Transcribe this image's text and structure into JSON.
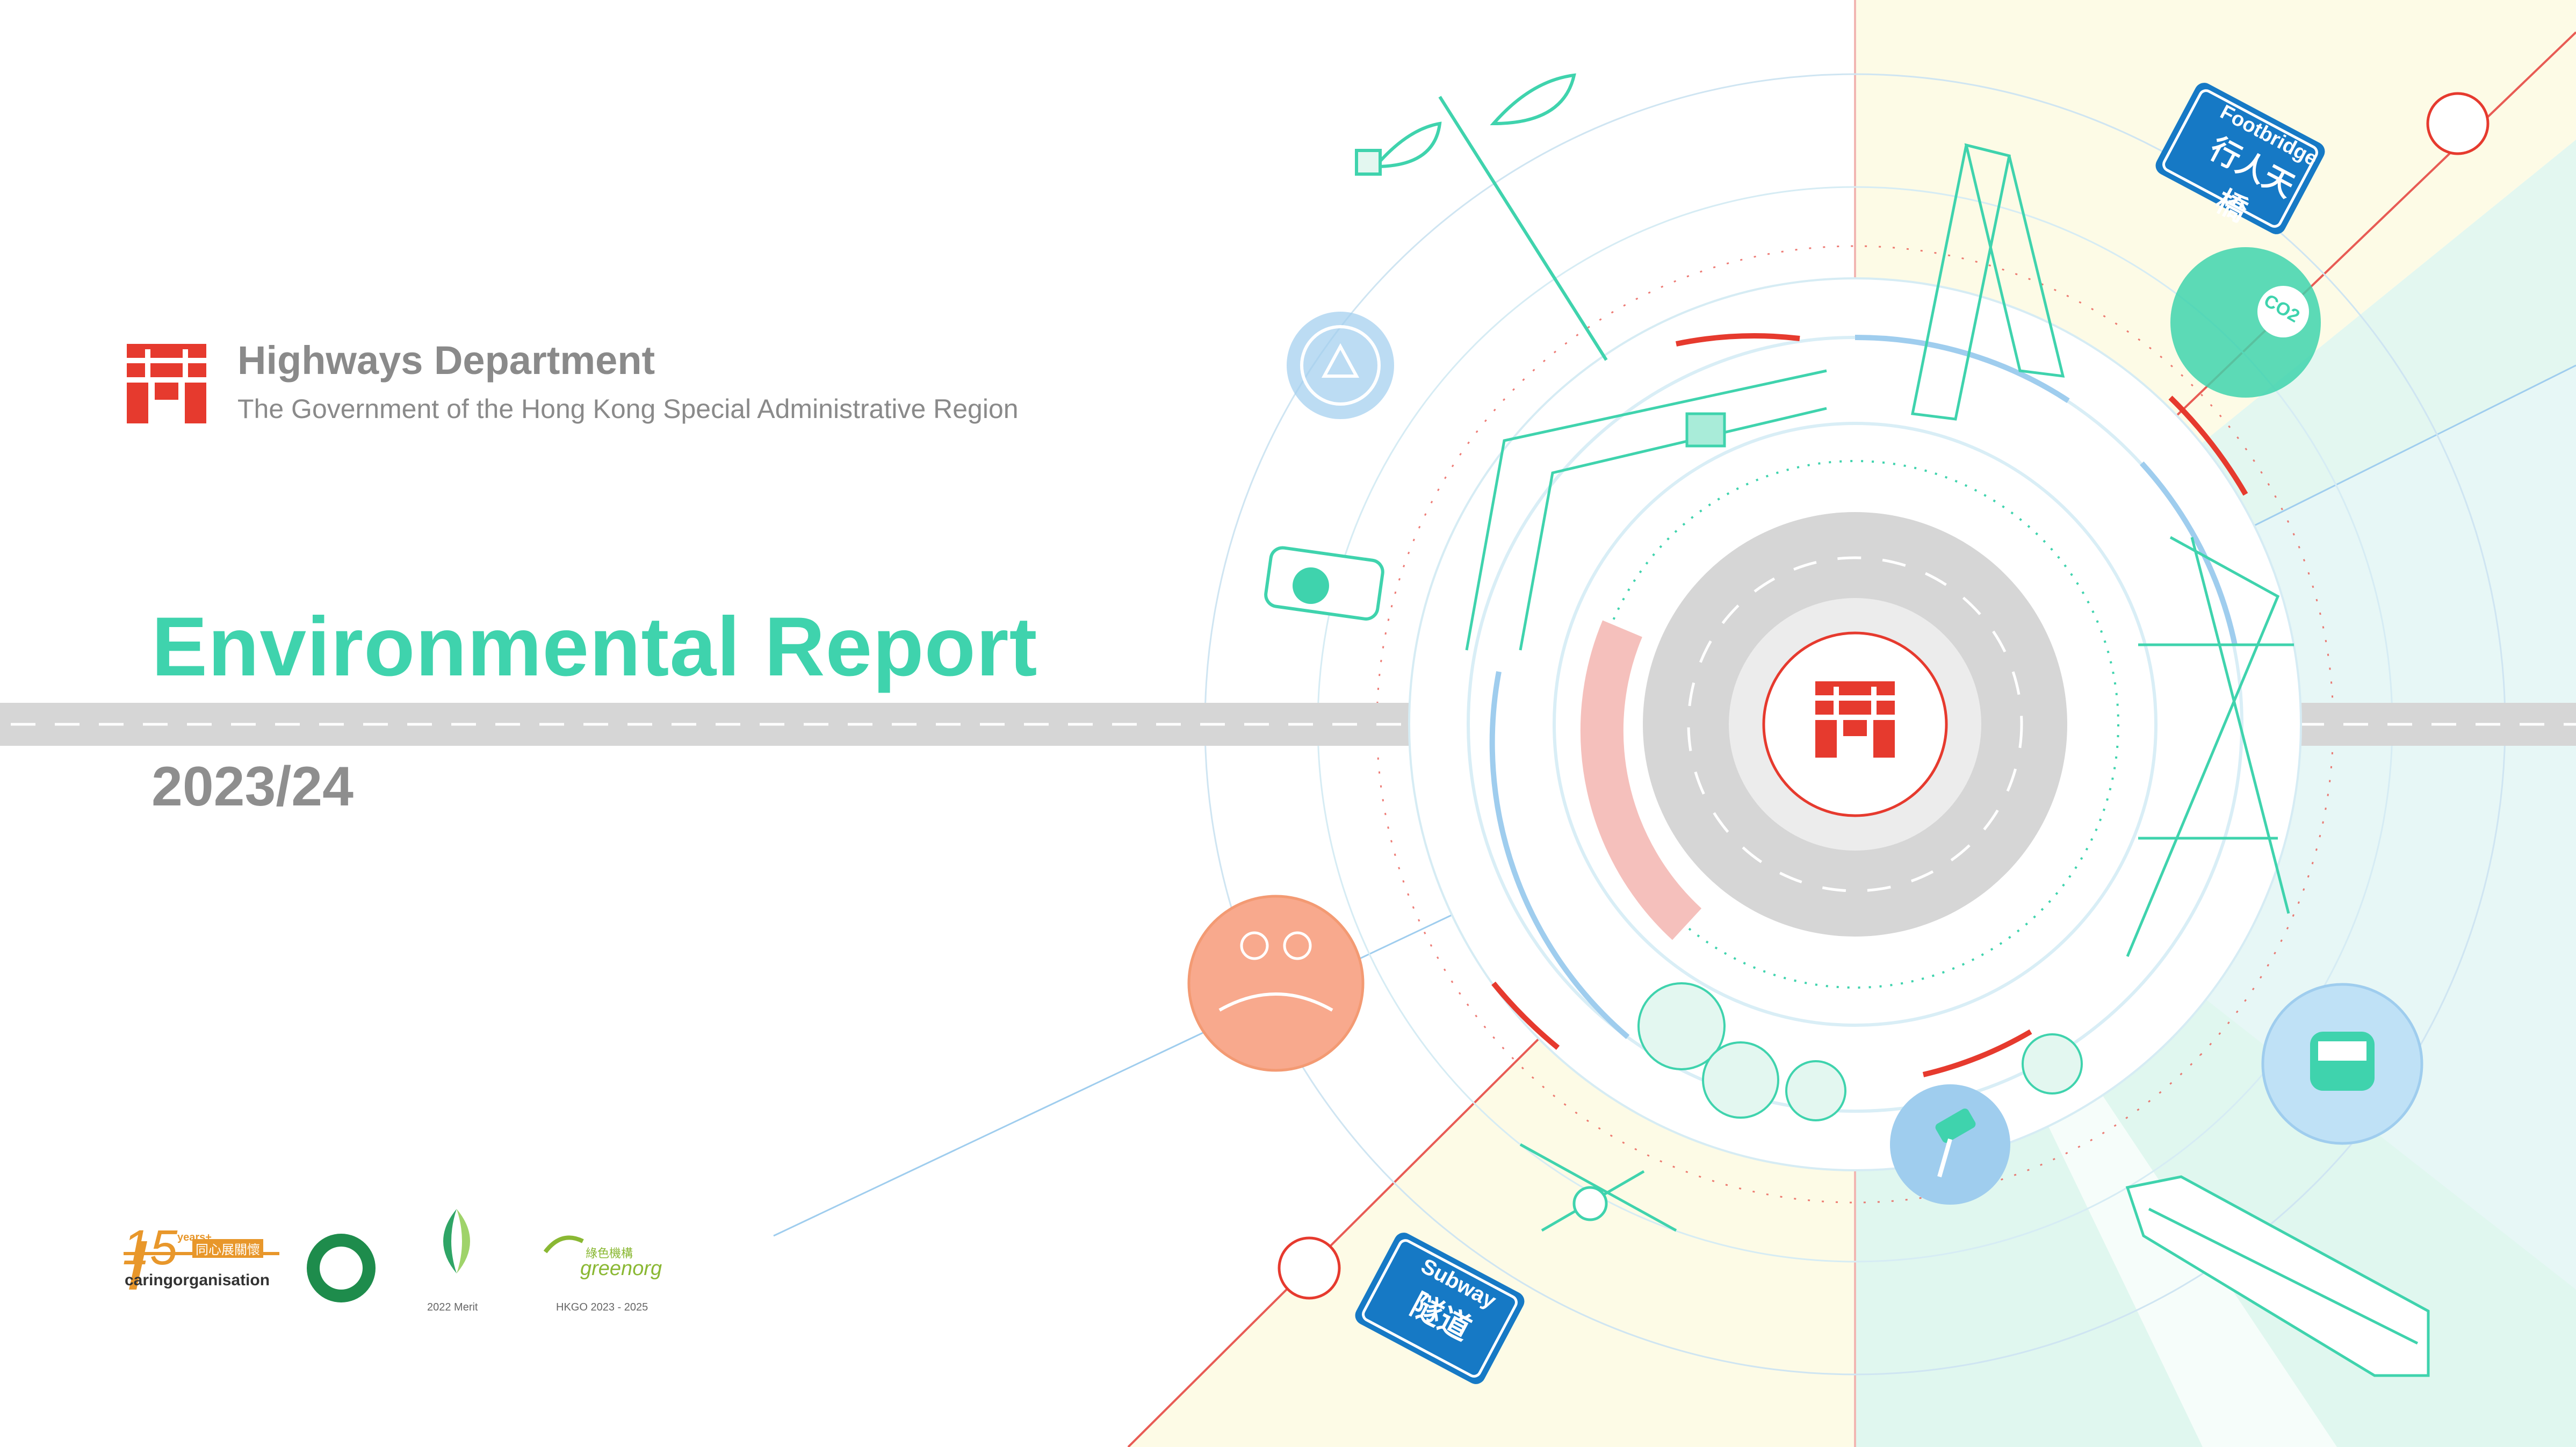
{
  "header": {
    "department": "Highways Department",
    "government": "The Government of the Hong Kong Special Administrative Region"
  },
  "report": {
    "title": "Environmental Report",
    "period": "2023/24"
  },
  "signs": {
    "footbridge_en": "Footbridge",
    "footbridge_zh": "行人天橋",
    "subway_en": "Subway",
    "subway_zh": "隧道"
  },
  "badges": {
    "caring_years": "15",
    "caring_years_suffix": "years+",
    "caring_zh": "同心展關懷",
    "caring_org": "caringorganisation",
    "merit_caption": "2022 Merit",
    "greenorg_label": "greenorg",
    "greenorg_zh": "綠色機構",
    "greenorg_caption": "HKGO 2023 - 2025"
  },
  "icons": {
    "co2_label": "CO2"
  },
  "colors": {
    "brand_red": "#e63a2e",
    "accent_green": "#3fd3ad",
    "road_gray": "#d6d6d6",
    "sky_blue": "#9fcdee",
    "sector_yellow": "#fdfbe6",
    "sector_mint": "#e3f7f0"
  }
}
